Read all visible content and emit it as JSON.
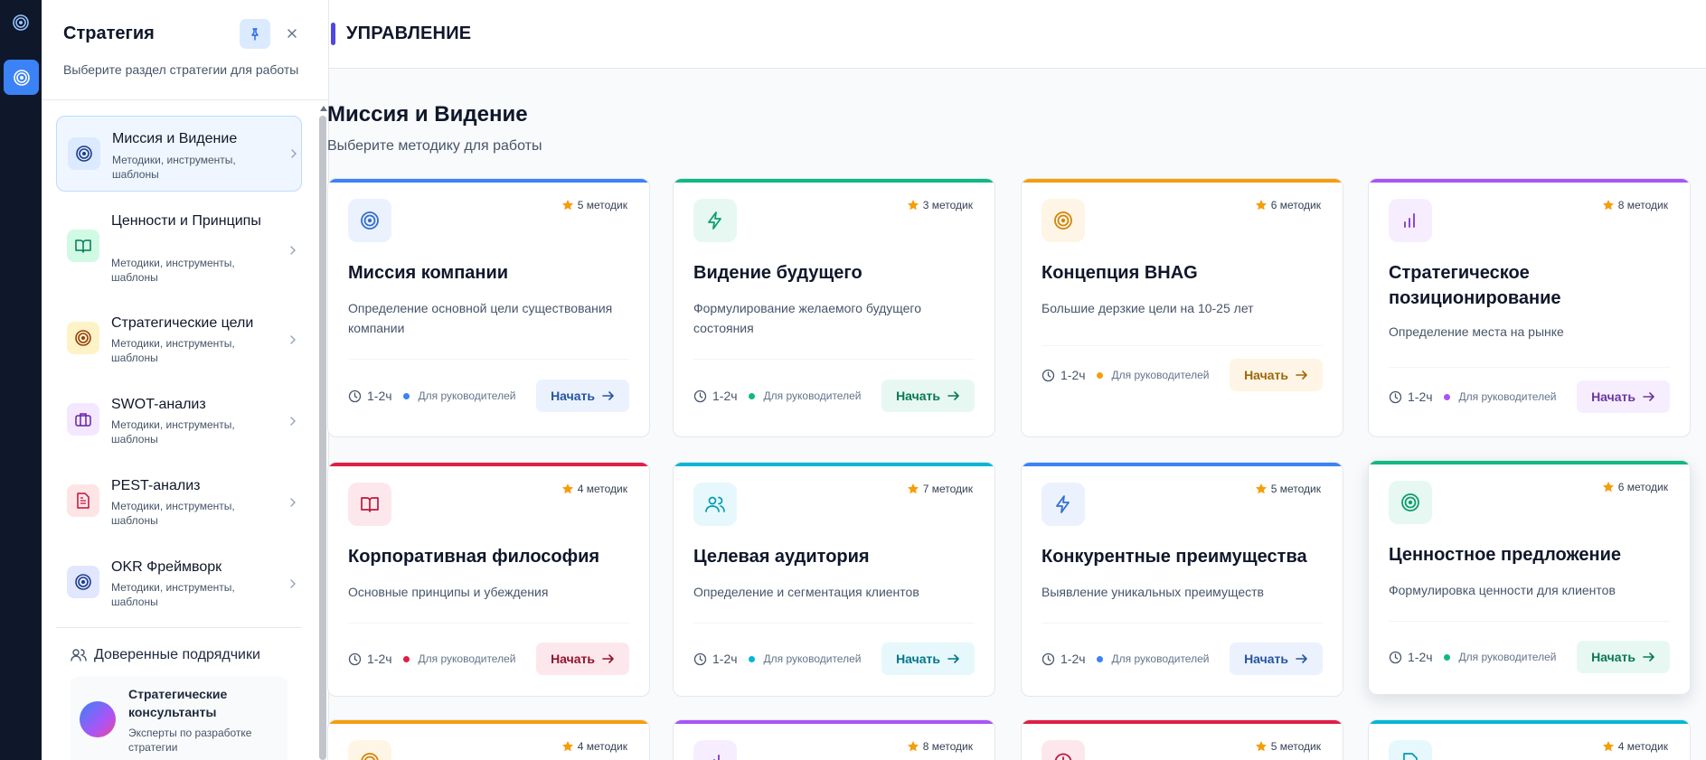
{
  "sidebar": {
    "title": "Стратегия",
    "subtitle": "Выберите раздел стратегии для работы",
    "items": [
      {
        "title": "Миссия и Видение",
        "desc": "Методики, инструменты, шаблоны",
        "icon": "target-icon",
        "color": "#1e3a8a"
      },
      {
        "title": "Ценности и Принципы",
        "desc": "Методики, инструменты, шаблоны",
        "icon": "book-icon",
        "color": "#047857"
      },
      {
        "title": "Стратегические цели",
        "desc": "Методики, инструменты, шаблоны",
        "icon": "target-icon",
        "color": "#92400e"
      },
      {
        "title": "SWOT-анализ",
        "desc": "Методики, инструменты, шаблоны",
        "icon": "briefcase-icon",
        "color": "#6b21a8"
      },
      {
        "title": "PEST-анализ",
        "desc": "Методики, инструменты, шаблоны",
        "icon": "document-icon",
        "color": "#be123c"
      },
      {
        "title": "OKR Фреймворк",
        "desc": "Методики, инструменты, шаблоны",
        "icon": "target-icon",
        "color": "#1e3a8a"
      }
    ],
    "trusted": {
      "title": "Доверенные подрядчики",
      "card": {
        "name": "Стратегические консультанты",
        "desc": "Эксперты по разработке стратегии"
      }
    }
  },
  "header": {
    "title": "УПРАВЛЕНИЕ"
  },
  "main": {
    "title": "Миссия и Видение",
    "subtitle": "Выберите методику для работы"
  },
  "cards": [
    {
      "title": "Миссия компании",
      "desc": "Определение основной цели существования компании",
      "badge": "5 методик",
      "time": "1-2ч",
      "audience": "Для руководителей",
      "button": "Начать",
      "accent": "#3b82f6",
      "icon": "target-icon"
    },
    {
      "title": "Видение будущего",
      "desc": "Формулирование желаемого будущего состояния",
      "badge": "3 методик",
      "time": "1-2ч",
      "audience": "Для руководителей",
      "button": "Начать",
      "accent": "#10b981",
      "icon": "lightning-icon"
    },
    {
      "title": "Концепция BHAG",
      "desc": "Большие дерзкие цели на 10-25 лет",
      "badge": "6 методик",
      "time": "1-2ч",
      "audience": "Для руководителей",
      "button": "Начать",
      "accent": "#f59e0b",
      "icon": "target-icon"
    },
    {
      "title": "Стратегическое позиционирование",
      "desc": "Определение места на рынке",
      "badge": "8 методик",
      "time": "1-2ч",
      "audience": "Для руководителей",
      "button": "Начать",
      "accent": "#a855f7",
      "icon": "bar-chart-icon"
    },
    {
      "title": "Корпоративная философия",
      "desc": "Основные принципы и убеждения",
      "badge": "4 методик",
      "time": "1-2ч",
      "audience": "Для руководителей",
      "button": "Начать",
      "accent": "#e11d48",
      "icon": "book-icon"
    },
    {
      "title": "Целевая аудитория",
      "desc": "Определение и сегментация клиентов",
      "badge": "7 методик",
      "time": "1-2ч",
      "audience": "Для руководителей",
      "button": "Начать",
      "accent": "#06b6d4",
      "icon": "users-icon"
    },
    {
      "title": "Конкурентные преимущества",
      "desc": "Выявление уникальных преимуществ",
      "badge": "5 методик",
      "time": "1-2ч",
      "audience": "Для руководителей",
      "button": "Начать",
      "accent": "#3b82f6",
      "icon": "lightning-icon"
    },
    {
      "title": "Ценностное предложение",
      "desc": "Формулировка ценности для клиентов",
      "badge": "6 методик",
      "time": "1-2ч",
      "audience": "Для руководителей",
      "button": "Начать",
      "accent": "#10b981",
      "icon": "target-icon"
    },
    {
      "badge": "4 методик",
      "accent": "#f59e0b",
      "icon": "target-icon"
    },
    {
      "badge": "8 методик",
      "accent": "#a855f7",
      "icon": "bar-chart-icon"
    },
    {
      "badge": "5 методик",
      "accent": "#e11d48",
      "icon": "clock-icon"
    },
    {
      "badge": "4 методик",
      "accent": "#06b6d4",
      "icon": "document-icon"
    }
  ]
}
